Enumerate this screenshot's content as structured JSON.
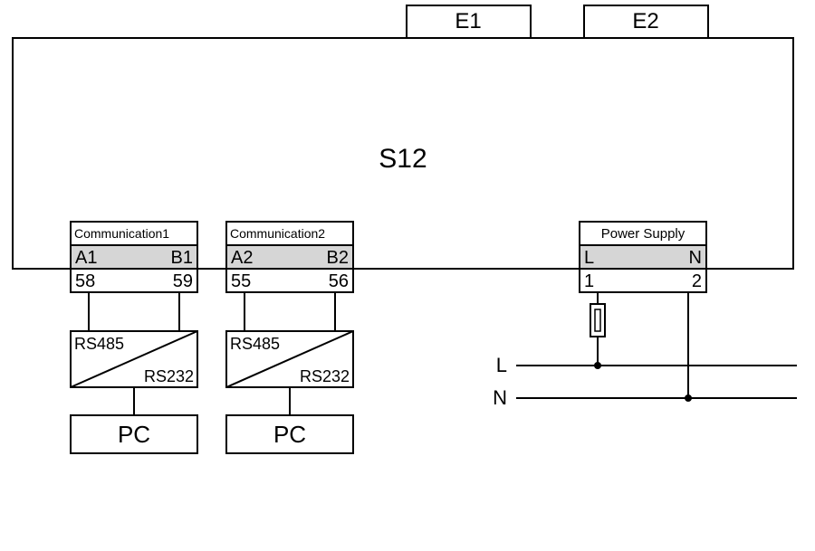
{
  "top": {
    "e1": "E1",
    "e2": "E2"
  },
  "main": {
    "title": "S12"
  },
  "comm1": {
    "title": "Communication1",
    "a": "A1",
    "b": "B1",
    "an": "58",
    "bn": "59",
    "conv_top": "RS485",
    "conv_bot": "RS232",
    "pc": "PC"
  },
  "comm2": {
    "title": "Communication2",
    "a": "A2",
    "b": "B2",
    "an": "55",
    "bn": "56",
    "conv_top": "RS485",
    "conv_bot": "RS232",
    "pc": "PC"
  },
  "power": {
    "title": "Power Supply",
    "l": "L",
    "n": "N",
    "ln": "1",
    "nn": "2",
    "line_l": "L",
    "line_n": "N"
  }
}
